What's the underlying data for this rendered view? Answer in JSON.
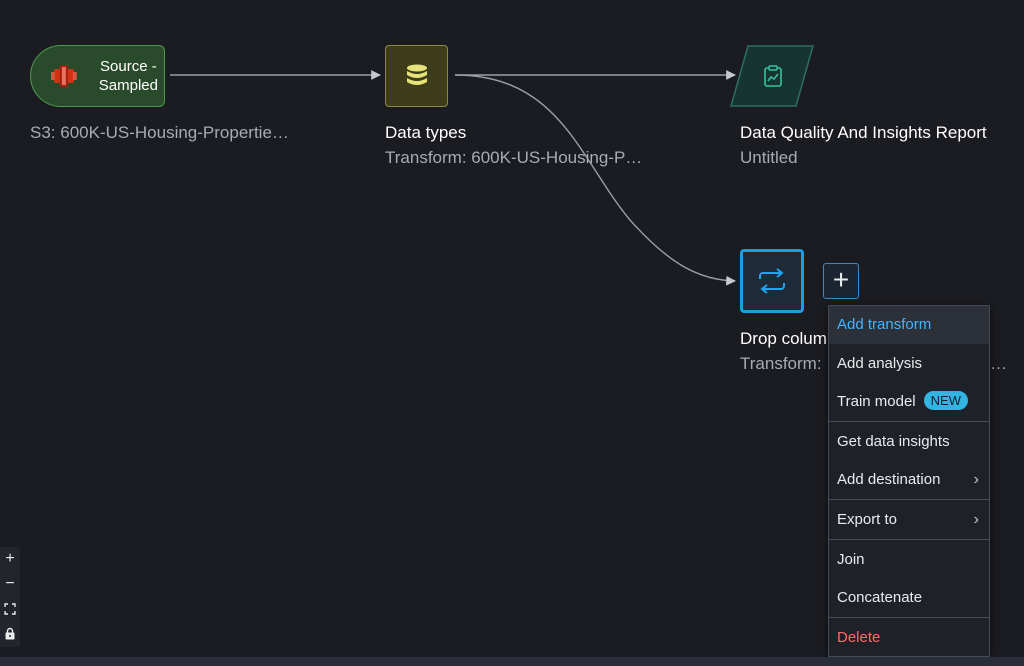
{
  "colors": {
    "canvas_bg": "#1b1c21",
    "source_fill": "#2a4a2c",
    "transform_fill": "#3d3d1c",
    "analysis_fill": "#173530",
    "selected_border": "#1a9fe0",
    "accent_text": "#42b4ff",
    "badge_bg": "#33b5e2",
    "danger_text": "#ff6b63"
  },
  "nodes": {
    "source": {
      "title": "Source - Sampled",
      "caption": "S3: 600K-US-Housing-Propertie…",
      "icon": "s3-bucket-icon"
    },
    "data_types": {
      "title": "Data types",
      "caption": "Transform: 600K-US-Housing-P…",
      "icon": "database-icon"
    },
    "report": {
      "title": "Data Quality And Insights Report",
      "caption": "Untitled",
      "icon": "report-clipboard-icon"
    },
    "drop_column": {
      "title": "Drop colum",
      "caption": "Transform:",
      "caption_suffix": "…",
      "icon": "transform-arrows-icon"
    }
  },
  "add_step_button": {
    "label": "+"
  },
  "context_menu": {
    "add_transform": "Add transform",
    "add_analysis": "Add analysis",
    "train_model": "Train model",
    "train_model_badge": "NEW",
    "get_data_insights": "Get data insights",
    "add_destination": "Add destination",
    "export_to": "Export to",
    "join": "Join",
    "concatenate": "Concatenate",
    "delete": "Delete",
    "submenu_chevron": "›"
  },
  "zoom_controls": {
    "zoom_in": "+",
    "zoom_out": "−"
  }
}
